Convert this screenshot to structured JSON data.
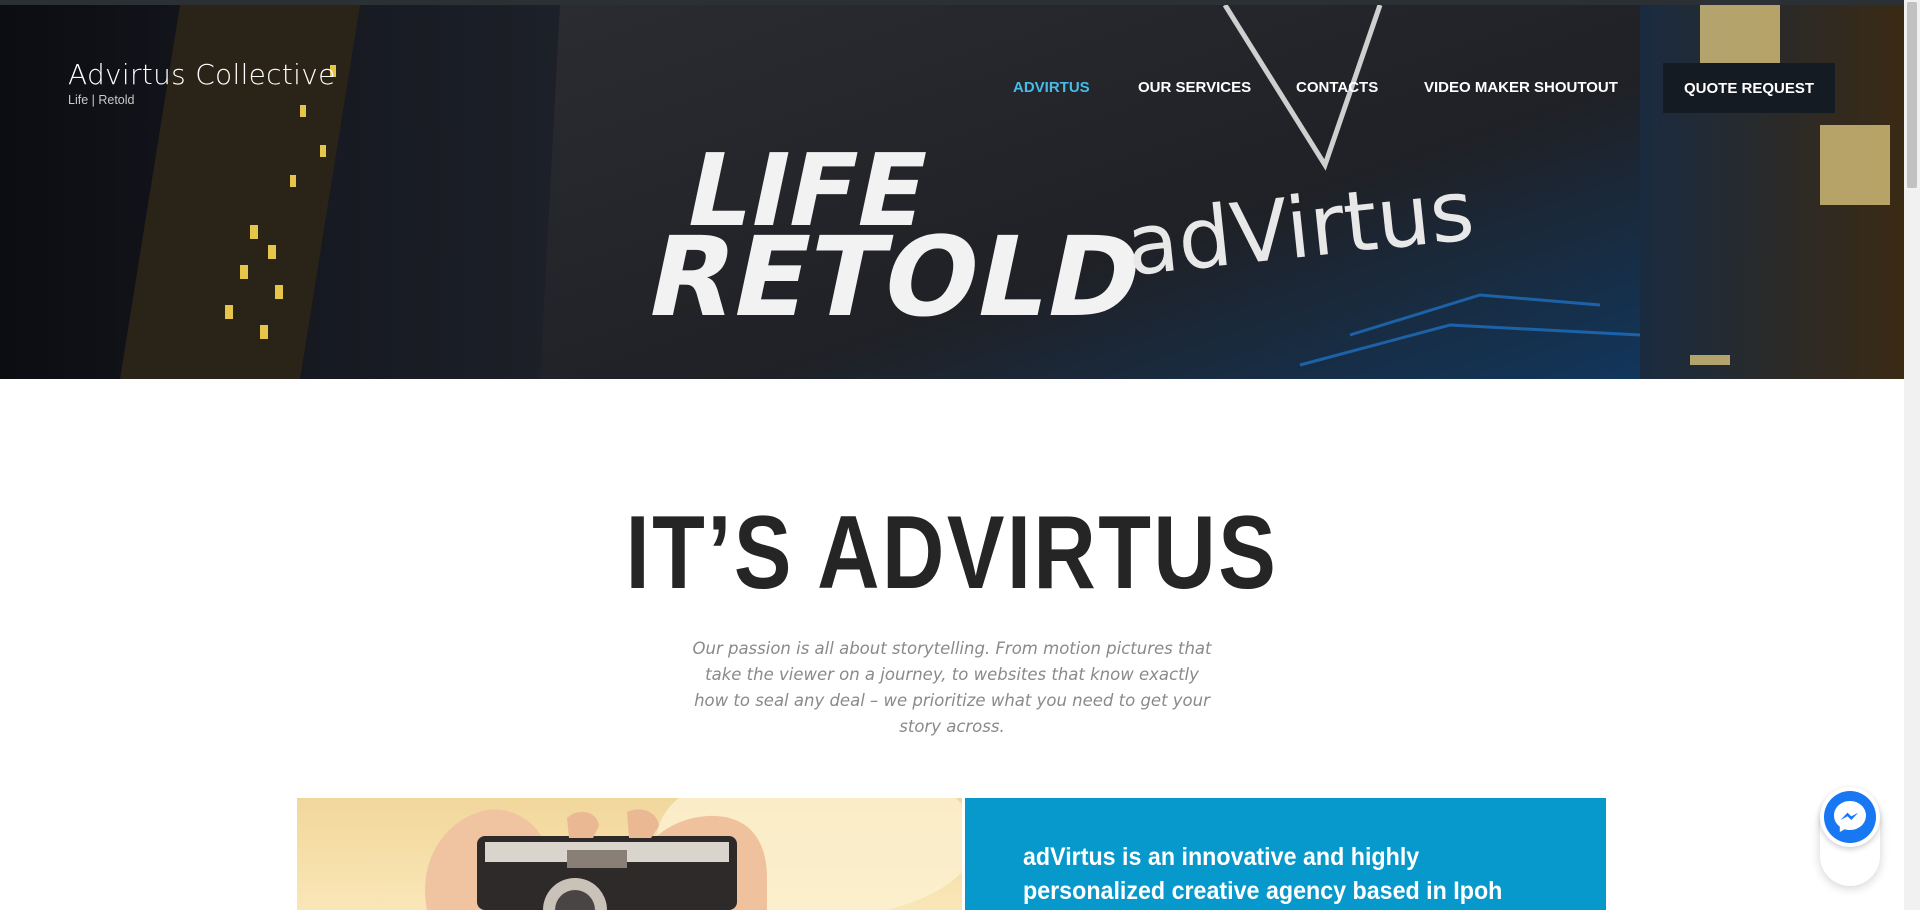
{
  "brand": {
    "title": "Advirtus Collective",
    "tagline": "Life | Retold"
  },
  "nav": {
    "items": [
      {
        "label": "ADVIRTUS",
        "active": true
      },
      {
        "label": "OUR SERVICES",
        "active": false
      },
      {
        "label": "CONTACTS",
        "active": false
      },
      {
        "label": "VIDEO MAKER SHOUTOUT",
        "active": false
      }
    ],
    "quote_button": "QUOTE REQUEST"
  },
  "hero": {
    "slogan_line1": "LIFE",
    "slogan_line2": "RETOLD",
    "logo_text": "adVirtus"
  },
  "main": {
    "headline": "IT’S ADVIRTUS",
    "intro": "Our passion is all about storytelling. From motion pictures that take the viewer on a journey, to websites that know exactly how to seal any deal – we prioritize what you need to get your story across.",
    "feature_text": "adVirtus is an innovative and highly personalized creative agency based in Ipoh with Asian reach. We"
  },
  "colors": {
    "accent": "#48bbe6",
    "feature_bg": "#0798cc",
    "button_bg": "#141b23",
    "heading": "#252525"
  },
  "icons": {
    "messenger": "messenger-icon"
  }
}
